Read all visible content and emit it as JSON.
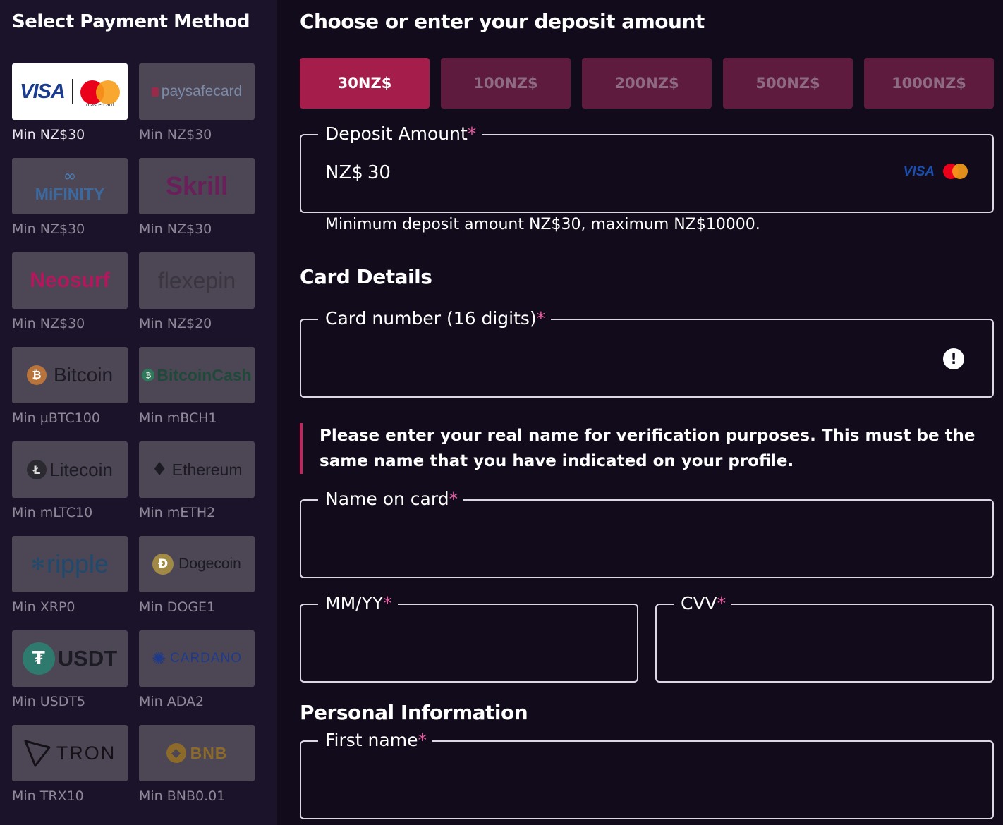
{
  "sidebar": {
    "title": "Select Payment Method",
    "methods": [
      {
        "logo": "",
        "min": "Min NZ$30"
      },
      {
        "logo": "paysafecard",
        "min": "Min NZ$30"
      },
      {
        "logo": "MiFINITY",
        "min": "Min NZ$30"
      },
      {
        "logo": "Skrill",
        "min": "Min NZ$30"
      },
      {
        "logo": "Neosurf",
        "min": "Min NZ$30"
      },
      {
        "logo": "flexepin",
        "min": "Min NZ$20"
      },
      {
        "logo": "Bitcoin",
        "min": "Min µBTC100"
      },
      {
        "logo": "BitcoinCash",
        "min": "Min mBCH1"
      },
      {
        "logo": "Litecoin",
        "min": "Min mLTC10"
      },
      {
        "logo": "Ethereum",
        "min": "Min mETH2"
      },
      {
        "logo": "ripple",
        "min": "Min XRP0"
      },
      {
        "logo": "Dogecoin",
        "min": "Min DOGE1"
      },
      {
        "logo": "USDT",
        "min": "Min USDT5"
      },
      {
        "logo": "CARDANO",
        "min": "Min ADA2"
      },
      {
        "logo": "TRON",
        "min": "Min TRX10"
      },
      {
        "logo": "BNB",
        "min": "Min BNB0.01"
      }
    ],
    "visa_mc": {
      "visa": "VISA",
      "mastercard": "mastercard"
    }
  },
  "main": {
    "heading": "Choose or enter your deposit amount",
    "amounts": [
      "30NZ$",
      "100NZ$",
      "200NZ$",
      "500NZ$",
      "1000NZ$"
    ],
    "selected_amount_index": 0,
    "deposit": {
      "label": "Deposit Amount",
      "currency": "NZ$",
      "value": "30",
      "visa": "VISA",
      "helper": "Minimum deposit amount NZ$30, maximum NZ$10000."
    },
    "card_details_heading": "Card Details",
    "card_number_label": "Card number (16 digits)",
    "card_number_error": "!",
    "notice": "Please enter your real name for verification purposes. This must be the same name that you have indicated on your profile.",
    "name_on_card_label": "Name on card",
    "expiry_label": "MM/YY",
    "cvv_label": "CVV",
    "personal_heading": "Personal Information",
    "first_name_label": "First name",
    "required_mark": "*"
  },
  "colors": {
    "background": "#120b1b",
    "sidebar": "#1b1329",
    "accent": "#a51e4b",
    "accent_muted": "#5e1b3d",
    "required": "#e85ea3"
  }
}
